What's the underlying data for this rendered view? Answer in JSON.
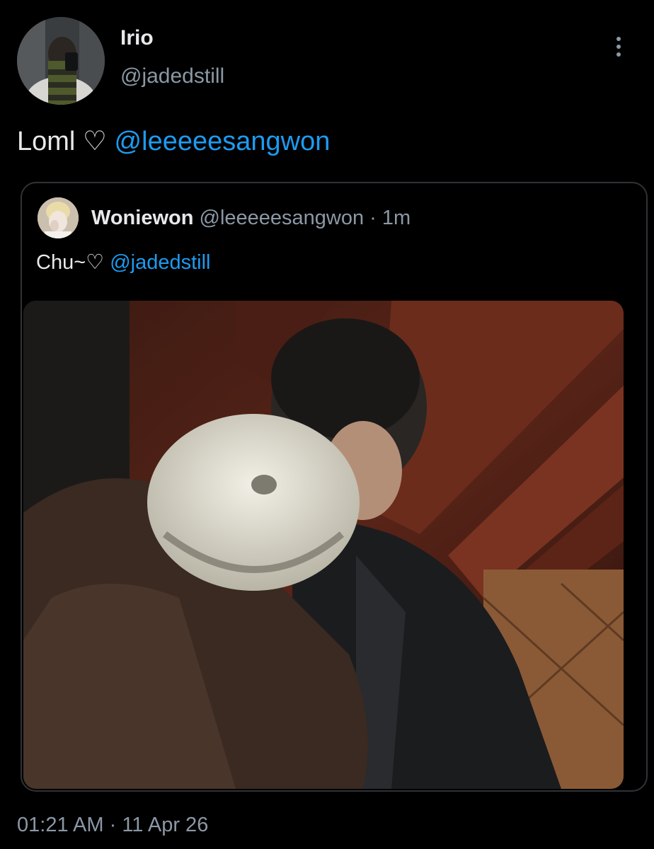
{
  "author": {
    "display_name": "Irio",
    "handle": "@jadedstill",
    "avatar_icon": "profile-photo-avatar"
  },
  "tweet": {
    "text": "Loml ♡ ",
    "mention": "@leeeeesangwon"
  },
  "more_icon": "more-vertical-icon",
  "quoted": {
    "display_name": "Woniewon",
    "handle": "@leeeeesangwon",
    "separator": " · ",
    "time_ago": "1m",
    "text": "Chu~♡ ",
    "mention": "@jadedstill",
    "media_icon": "photo-media"
  },
  "timestamp": {
    "time": "01:21 AM",
    "separator": " · ",
    "date": "11 Apr 26"
  },
  "colors": {
    "background": "#000000",
    "primary_text": "#e7e9ea",
    "secondary_text": "#8b98a5",
    "link": "#1d9bf0",
    "border": "#2f3336"
  }
}
